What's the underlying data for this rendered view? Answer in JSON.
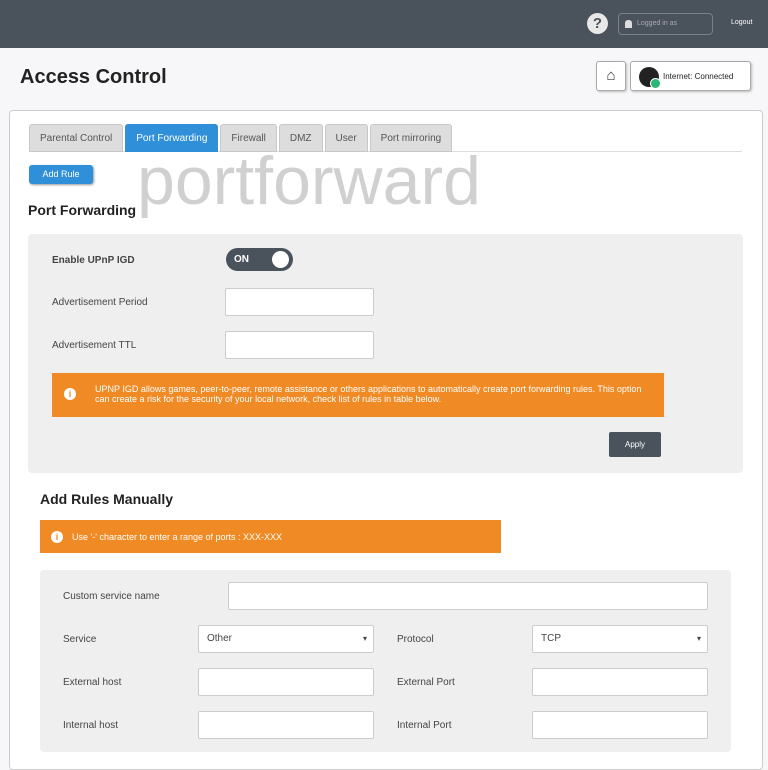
{
  "header": {
    "help_icon": "?",
    "logged_in": "Logged in as",
    "logout": "Logout"
  },
  "page_title": "Access Control",
  "internet": {
    "label": "Internet:",
    "status": "Connected"
  },
  "tabs": [
    {
      "label": "Parental Control"
    },
    {
      "label": "Port Forwarding",
      "active": true
    },
    {
      "label": "Firewall"
    },
    {
      "label": "DMZ"
    },
    {
      "label": "User"
    },
    {
      "label": "Port mirroring"
    }
  ],
  "add_rule": "Add Rule",
  "watermark": "portforward",
  "section_title": "Port Forwarding",
  "upnp": {
    "enable_label": "Enable UPnP IGD",
    "toggle": "ON",
    "adv_period_label": "Advertisement Period",
    "adv_period": "",
    "adv_ttl_label": "Advertisement TTL",
    "adv_ttl": "",
    "warning": "UPNP IGD allows games, peer-to-peer, remote assistance or others applications to automatically create port forwarding rules. This option can create a risk for the security of your local network, check list of rules in table below.",
    "apply": "Apply"
  },
  "manual": {
    "title": "Add Rules Manually",
    "hint": "Use '-' character to enter a range of ports : XXX-XXX",
    "custom_name_label": "Custom service name",
    "custom_name": "",
    "service_label": "Service",
    "service": "Other",
    "protocol_label": "Protocol",
    "protocol": "TCP",
    "ext_host_label": "External host",
    "ext_port_label": "External Port",
    "int_host_label": "Internal host",
    "int_port_label": "Internal Port"
  },
  "colors": {
    "accent": "#2f8fd8",
    "warning": "#f08a24",
    "header": "#4a525b"
  }
}
